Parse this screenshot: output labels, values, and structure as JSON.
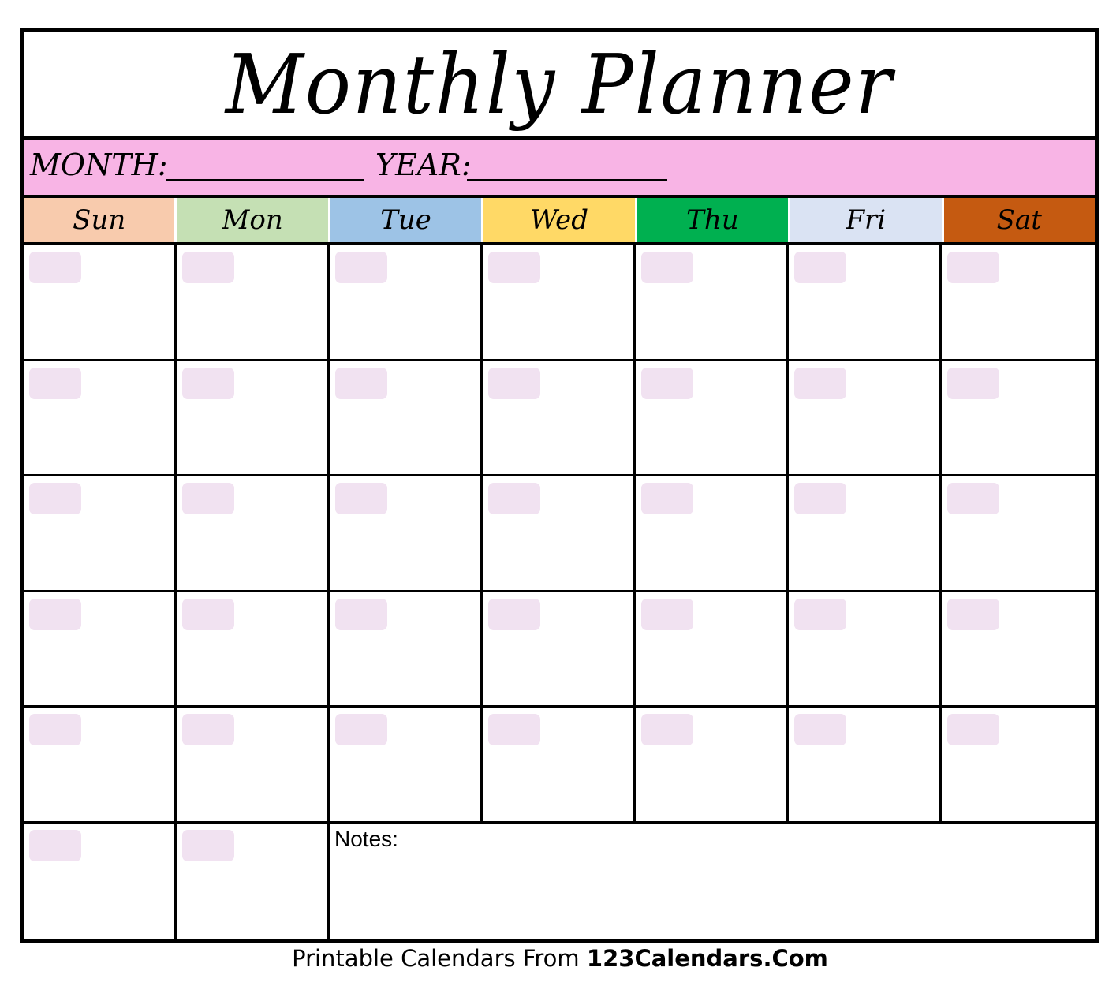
{
  "header": {
    "title": "Monthly Planner"
  },
  "fields": {
    "month_label": "MONTH:",
    "year_label": "YEAR:"
  },
  "days": [
    {
      "label": "Sun",
      "color": "#f8cbad"
    },
    {
      "label": "Mon",
      "color": "#c5e0b4"
    },
    {
      "label": "Tue",
      "color": "#9dc3e6"
    },
    {
      "label": "Wed",
      "color": "#ffd966"
    },
    {
      "label": "Thu",
      "color": "#00b050"
    },
    {
      "label": "Fri",
      "color": "#dae3f3"
    },
    {
      "label": "Sat",
      "color": "#c55a11"
    }
  ],
  "colors": {
    "month_bar": "#f8b4e5",
    "date_box": "#f1e2f1",
    "border": "#000000"
  },
  "notes": {
    "label": "Notes:"
  },
  "footer": {
    "prefix": "Printable Calendars From ",
    "brand": "123Calendars.Com"
  }
}
